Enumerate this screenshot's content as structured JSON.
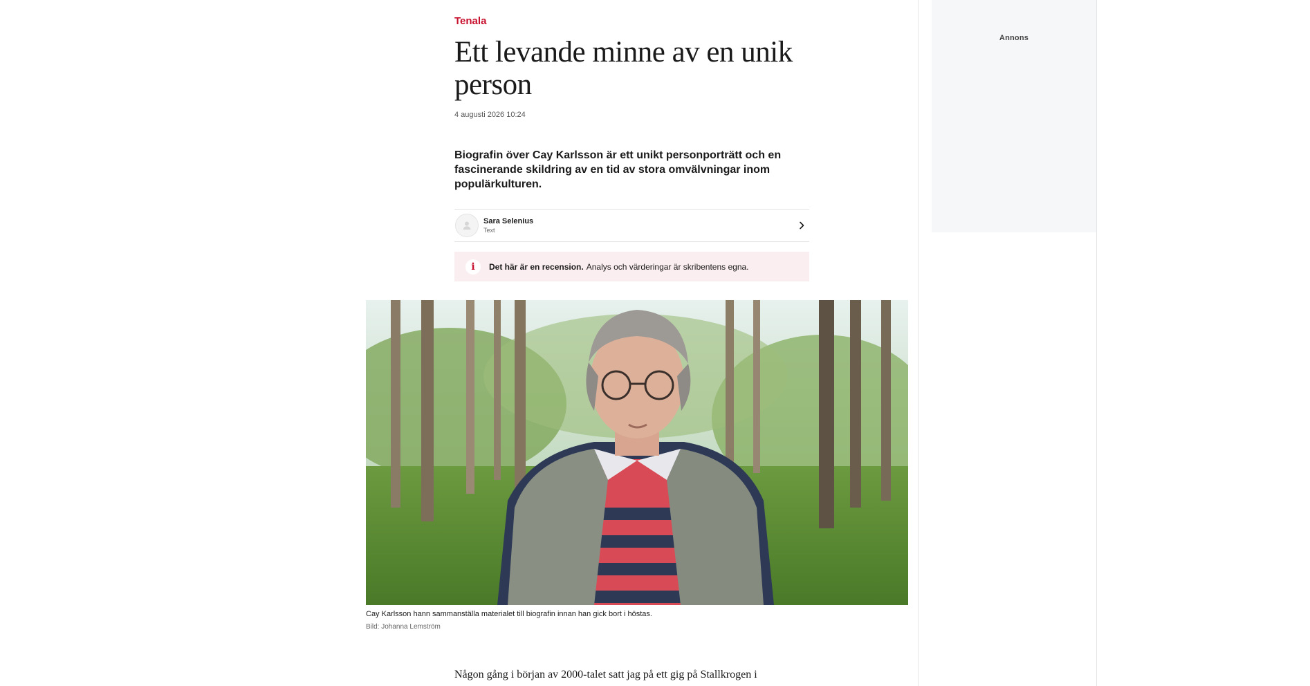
{
  "article": {
    "kicker": "Tenala",
    "headline": "Ett levande minne av en unik person",
    "date": "4 augusti 2026 10:24",
    "lead": "Biografin över Cay Karlsson är ett unikt personporträtt och en fascinerande skildring av en tid av stora omvälvningar inom populärkulturen.",
    "author": {
      "name": "Sara Selenius",
      "role": "Text",
      "avatar_icon": "user-icon",
      "chevron_icon": "chevron-right-icon"
    },
    "notice": {
      "icon": "info-icon",
      "icon_glyph": "i",
      "bold": "Det här är en recension.",
      "text": "Analys och värderingar är skribentens egna."
    },
    "image": {
      "caption": "Cay Karlsson hann sammanställa materialet till biografin innan han gick bort i höstas.",
      "credit": "Bild: Johanna Lemström"
    },
    "body_first_line": "Någon gång i början av 2000-talet satt jag på ett gig på Stallkrogen i"
  },
  "ad": {
    "label": "Annons"
  },
  "colors": {
    "accent": "#c8102e",
    "notice_bg": "#fbeef0",
    "ad_bg": "#f6f7f9"
  }
}
